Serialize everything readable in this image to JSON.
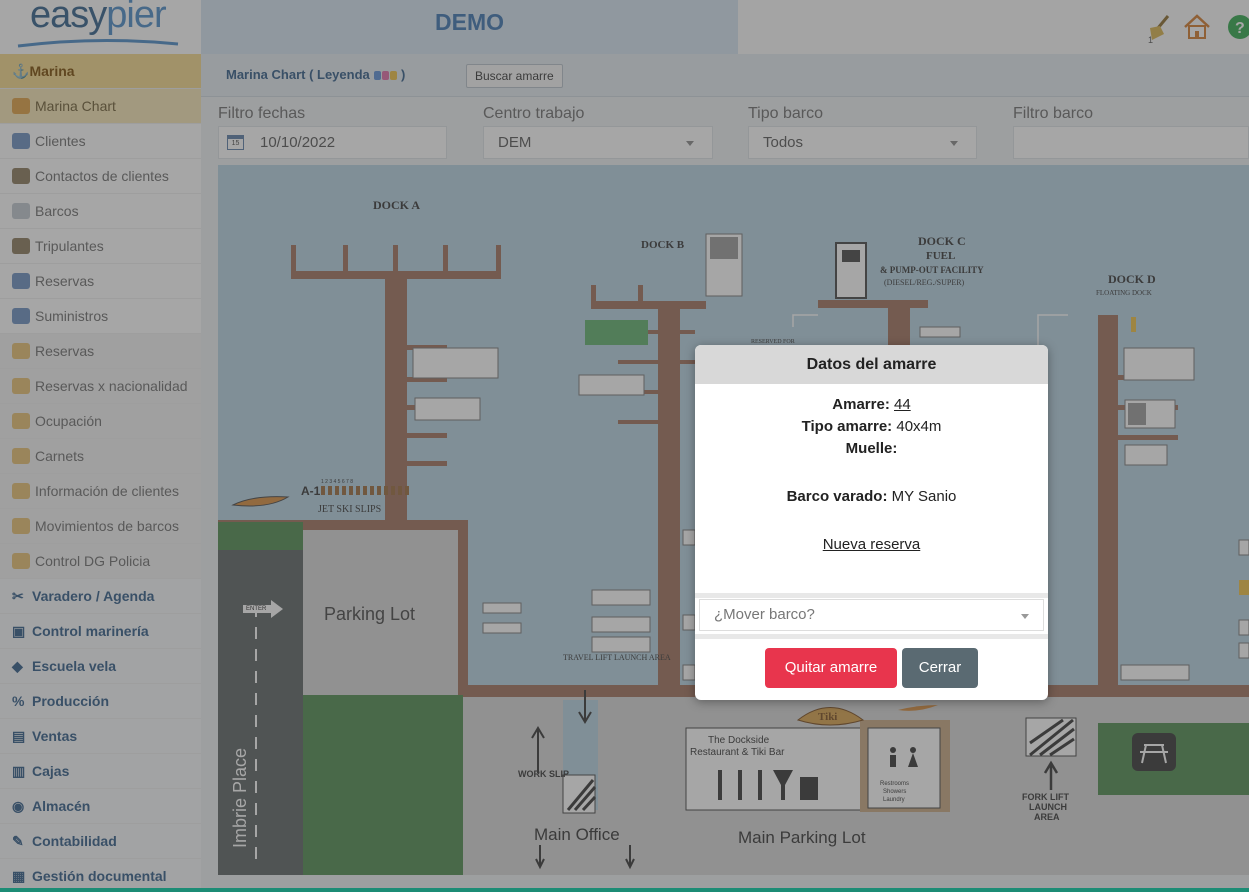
{
  "header": {
    "logo_easy": "easy",
    "logo_pier": "pier",
    "title": "DEMO",
    "broom_badge": "1"
  },
  "sidebar": {
    "items": [
      {
        "label": "Marina",
        "icon": "ship-icon",
        "kind": "section-active"
      },
      {
        "label": "Marina Chart",
        "icon": "map-icon",
        "kind": "active"
      },
      {
        "label": "Clientes",
        "icon": "client-card-icon",
        "kind": "item"
      },
      {
        "label": "Contactos de clientes",
        "icon": "contacts-icon",
        "kind": "item"
      },
      {
        "label": "Barcos",
        "icon": "boat-icon",
        "kind": "item"
      },
      {
        "label": "Tripulantes",
        "icon": "crew-icon",
        "kind": "item"
      },
      {
        "label": "Reservas",
        "icon": "reservation-icon",
        "kind": "item"
      },
      {
        "label": "Suministros",
        "icon": "supplies-icon",
        "kind": "item"
      },
      {
        "label": "Reservas",
        "icon": "report-icon",
        "kind": "sub"
      },
      {
        "label": "Reservas x nacionalidad",
        "icon": "report-icon",
        "kind": "sub"
      },
      {
        "label": "Ocupación",
        "icon": "report-icon",
        "kind": "sub"
      },
      {
        "label": "Carnets",
        "icon": "report-icon",
        "kind": "sub"
      },
      {
        "label": "Información de clientes",
        "icon": "report-icon",
        "kind": "sub"
      },
      {
        "label": "Movimientos de barcos",
        "icon": "report-icon",
        "kind": "sub"
      },
      {
        "label": "Control DG Policia",
        "icon": "report-icon",
        "kind": "sub"
      },
      {
        "label": "Varadero / Agenda",
        "icon": "tools-icon",
        "kind": "section"
      },
      {
        "label": "Control marinería",
        "icon": "clipboard-icon",
        "kind": "section"
      },
      {
        "label": "Escuela vela",
        "icon": "graduation-icon",
        "kind": "section"
      },
      {
        "label": "Producción",
        "icon": "production-icon",
        "kind": "section"
      },
      {
        "label": "Ventas",
        "icon": "sales-icon",
        "kind": "section"
      },
      {
        "label": "Cajas",
        "icon": "cash-icon",
        "kind": "section"
      },
      {
        "label": "Almacén",
        "icon": "warehouse-icon",
        "kind": "section"
      },
      {
        "label": "Contabilidad",
        "icon": "pencil-icon",
        "kind": "section"
      },
      {
        "label": "Gestión documental",
        "icon": "document-icon",
        "kind": "section"
      }
    ]
  },
  "subbar": {
    "title": "Marina Chart ( Leyenda",
    "title_close": ")",
    "legend_colors": [
      "#5b8fd6",
      "#e06aa8",
      "#f0c040"
    ],
    "search_button": "Buscar amarre"
  },
  "filters": {
    "date_label": "Filtro fechas",
    "date_value": "10/10/2022",
    "center_label": "Centro trabajo",
    "center_value": "DEM",
    "boat_type_label": "Tipo barco",
    "boat_type_value": "Todos",
    "boat_filter_label": "Filtro barco",
    "boat_filter_value": ""
  },
  "chart": {
    "dock_a": "DOCK A",
    "dock_b": "DOCK B",
    "dock_c": "DOCK C",
    "dock_c_fuel": "FUEL",
    "dock_c_pump": "& PUMP-OUT FACILITY",
    "dock_c_diesel": "(DIESEL/REG./SUPER)",
    "dock_d": "DOCK D",
    "dock_d_sub": "FLOATING DOCK",
    "reserved_for": "RESERVED FOR",
    "a1": "A-1",
    "a1_numbers": "1 2 3 4 5 6 7 8",
    "jet_ski": "JET SKI SLIPS",
    "enter": "ENTER",
    "parking_lot": "Parking Lot",
    "imbrie": "Imbrie Place",
    "travel_lift": "TRAVEL LIFT LAUNCH AREA",
    "work_slip": "WORK SLIP",
    "main_office": "Main Office",
    "main_parking": "Main Parking  Lot",
    "dockside_1": "The Dockside",
    "dockside_2": "Restaurant & Tiki Bar",
    "tiki": "Tiki",
    "restrooms": "Restrooms",
    "showers": "Showers",
    "laundry": "Laundry",
    "fork_lift_1": "FORK LIFT",
    "fork_lift_2": "LAUNCH",
    "fork_lift_3": "AREA"
  },
  "modal": {
    "title": "Datos del amarre",
    "amarre_label": "Amarre:",
    "amarre_value": "44",
    "tipo_label": "Tipo amarre:",
    "tipo_value": "40x4m",
    "muelle_label": "Muelle:",
    "muelle_value": "",
    "barco_label": "Barco varado:",
    "barco_value": "MY Sanio",
    "nueva_reserva": "Nueva reserva",
    "mover_placeholder": "¿Mover barco?",
    "quitar_button": "Quitar amarre",
    "cerrar_button": "Cerrar"
  },
  "colors": {
    "accent_blue": "#3b73b0",
    "danger": "#e8354d",
    "secondary": "#5a6a72",
    "water": "#b7d3e3",
    "dock_wood": "#a0705a"
  }
}
